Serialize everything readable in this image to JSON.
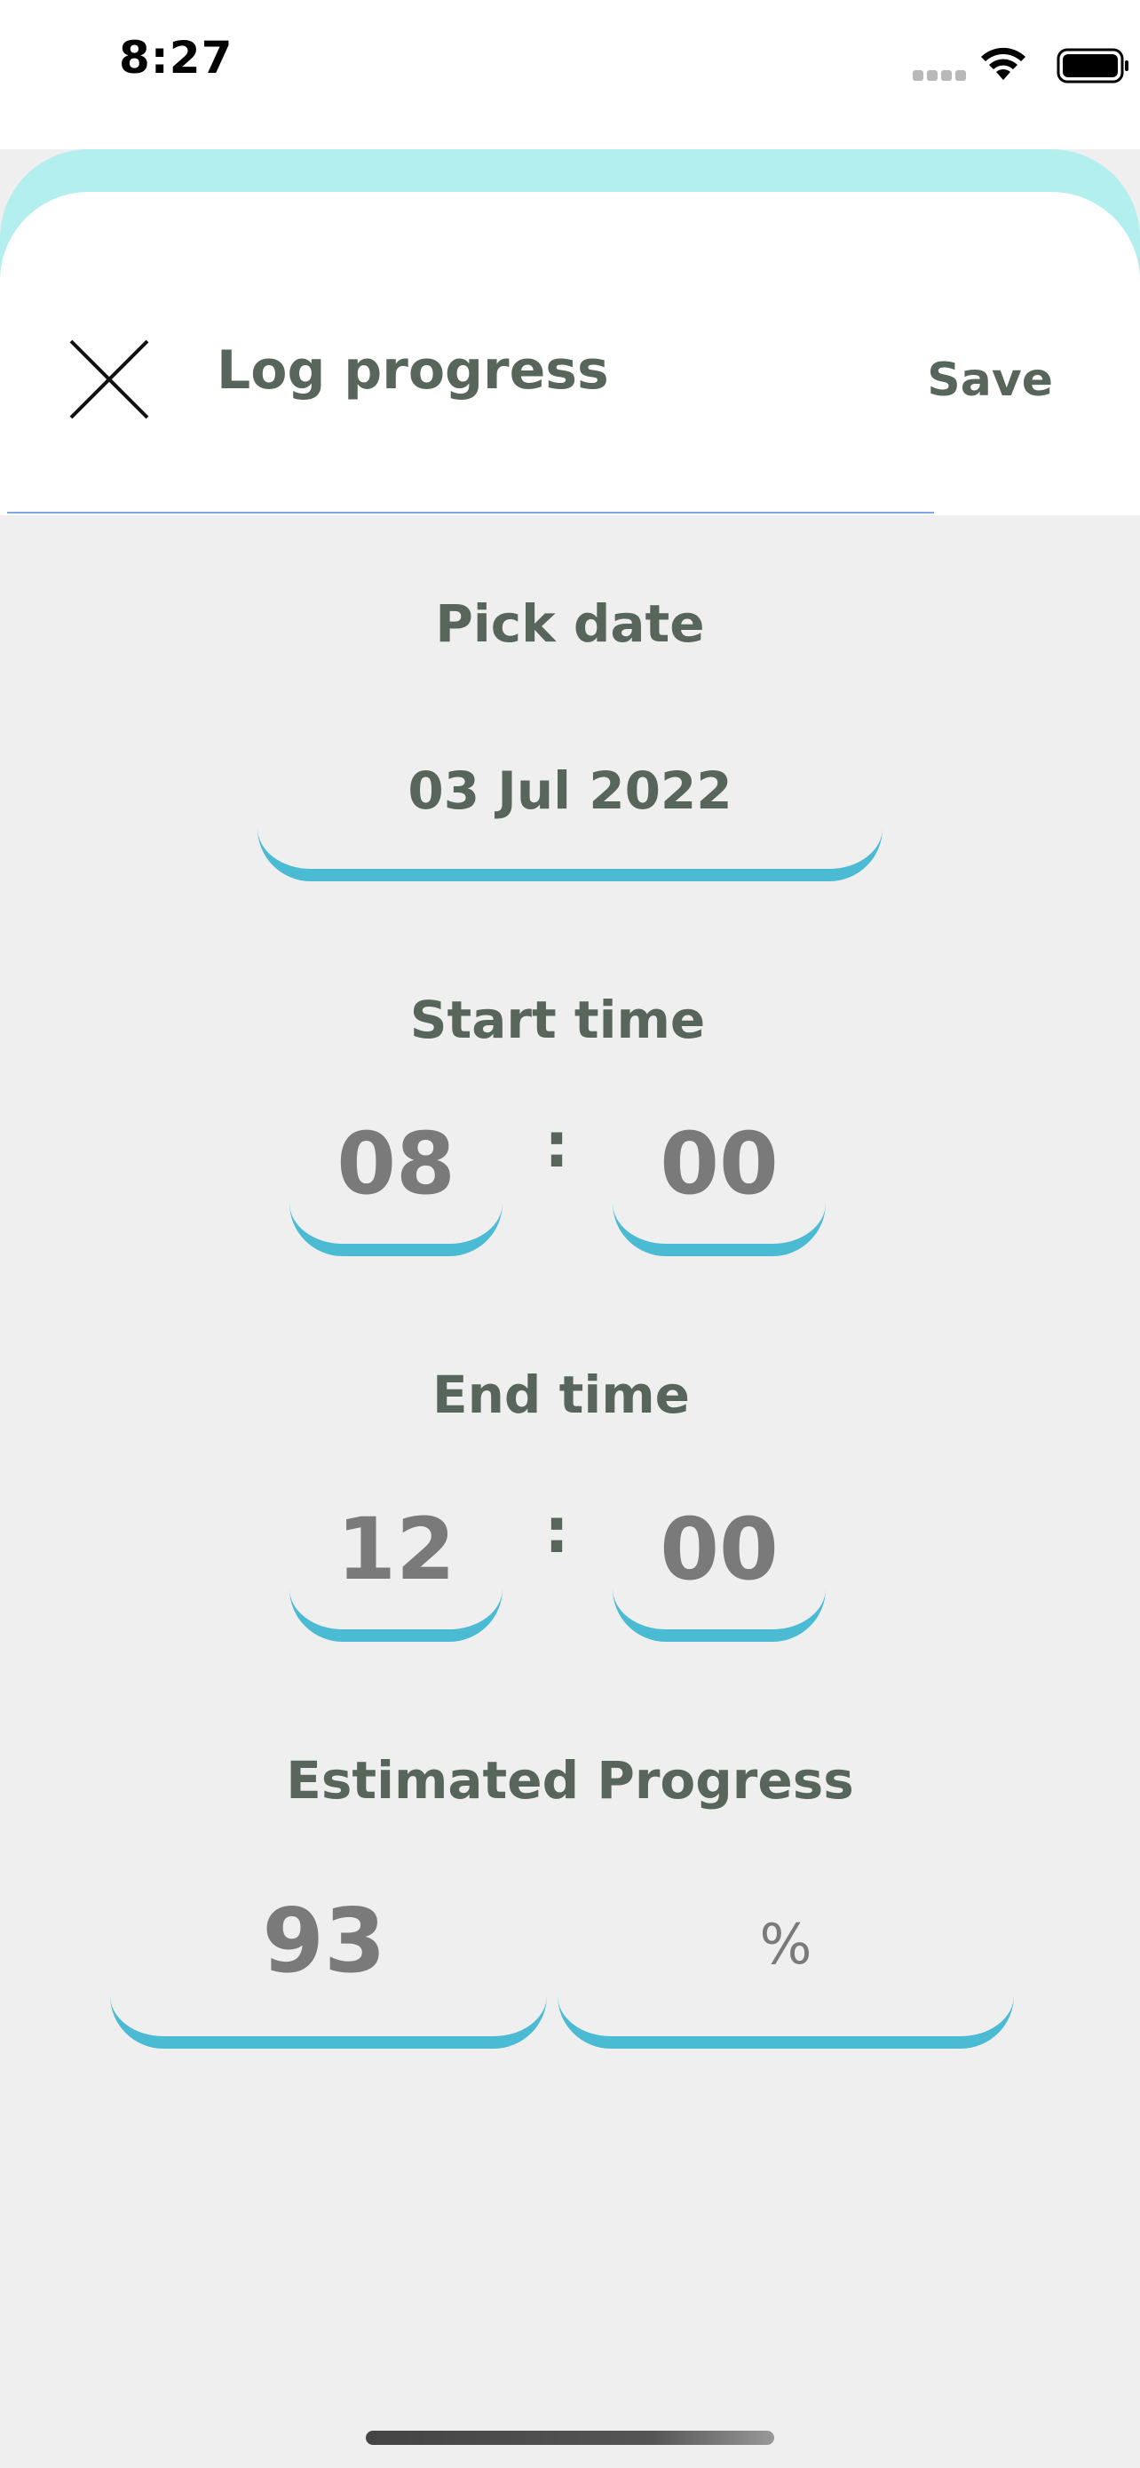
{
  "status_bar": {
    "time": "8:27",
    "icons": [
      "signal-icon",
      "wifi-icon",
      "battery-icon"
    ]
  },
  "header": {
    "title": "Log progress",
    "save_label": "Save",
    "close_icon": "close-icon"
  },
  "date_section": {
    "label": "Pick date",
    "value": "03 Jul 2022"
  },
  "start_time": {
    "label": "Start time",
    "hours": "08",
    "separator": ":",
    "minutes": "00"
  },
  "end_time": {
    "label": "End time",
    "hours": "12",
    "separator": ":",
    "minutes": "00"
  },
  "progress": {
    "label": "Estimated Progress",
    "value": "93",
    "unit": "%"
  },
  "colors": {
    "accent": "#4bbbd3",
    "sheet_top": "#b3efee",
    "text": "#58655a",
    "background": "#efefef"
  }
}
